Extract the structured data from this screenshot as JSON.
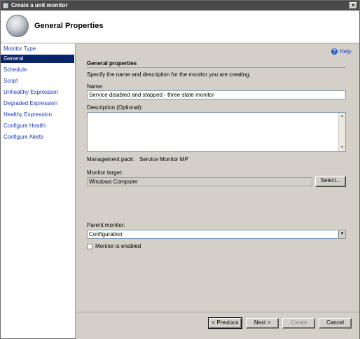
{
  "window": {
    "title": "Create a unit monitor",
    "close_label": "×"
  },
  "header": {
    "title": "General Properties"
  },
  "sidebar": {
    "items": [
      {
        "label": "Monitor Type"
      },
      {
        "label": "General"
      },
      {
        "label": "Schedule"
      },
      {
        "label": "Script"
      },
      {
        "label": "Unhealthy Expression"
      },
      {
        "label": "Degraded Expression"
      },
      {
        "label": "Healthy Expression"
      },
      {
        "label": "Configure Health"
      },
      {
        "label": "Configure Alerts"
      }
    ],
    "selected_index": 1
  },
  "main": {
    "help_label": "Help",
    "help_icon_glyph": "?",
    "section_title": "General properties",
    "instructions": "Specify the name and description for the monitor you are creating.",
    "name_label": "Name:",
    "name_value": "Service disabled and stopped - three state monitor",
    "description_label": "Description (Optional):",
    "description_value": "",
    "management_pack_label": "Management pack:",
    "management_pack_value": "Service Monitor MP",
    "monitor_target_label": "Monitor target:",
    "monitor_target_value": "Windows Computer",
    "select_button": "Select...",
    "parent_monitor_label": "Parent monitor:",
    "parent_monitor_value": "Configuration",
    "monitor_enabled_label": "Monitor is enabled",
    "monitor_enabled_checked": false
  },
  "footer": {
    "previous": "< Previous",
    "next": "Next >",
    "create": "Create",
    "cancel": "Cancel"
  }
}
